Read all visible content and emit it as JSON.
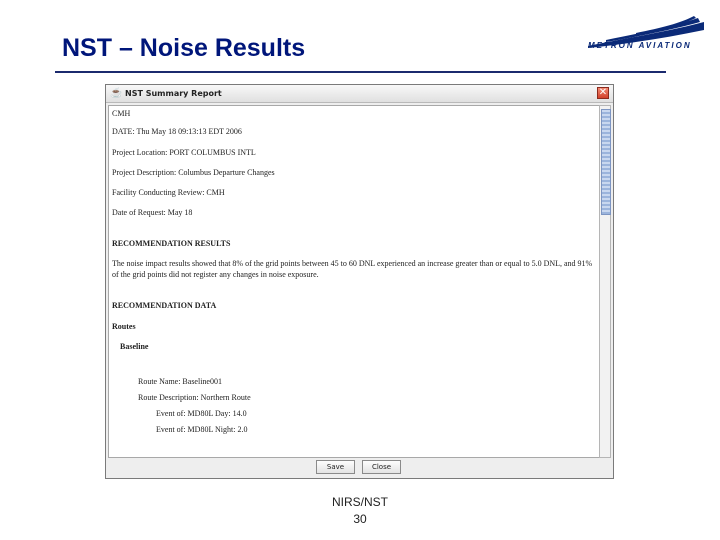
{
  "slide": {
    "title": "NST – Noise Results",
    "logo_text": "METRON AVIATION",
    "footer_line1": "NIRS/NST",
    "footer_line2": "30"
  },
  "dialog": {
    "title": "NST Summary Report",
    "close_glyph": "✕",
    "report": {
      "airport": "CMH",
      "date": "DATE: Thu May 18 09:13:13 EDT 2006",
      "facility": "Project Location: PORT COLUMBUS INTL",
      "description": "Project Description: Columbus Departure Changes",
      "conducting": "Facility Conducting Review: CMH",
      "requested": "Date of Request: May 18",
      "results_heading": "RECOMMENDATION RESULTS",
      "results_text": "The noise impact results showed that 8% of the grid points between 45 to 60 DNL experienced an increase greater than or equal to 5.0 DNL, and 91% of the grid points did not register any changes in noise exposure.",
      "data_heading": "RECOMMENDATION DATA",
      "routes_heading": "Routes",
      "baseline_heading": "Baseline",
      "route_name": "Route Name:       Baseline001",
      "route_description": "Route Description: Northern Route",
      "event_day": "Event of: MD80L Day: 14.0",
      "event_night": "Event of: MD80L Night: 2.0"
    },
    "buttons": {
      "save": "Save",
      "close": "Close"
    }
  },
  "colors": {
    "title": "#00167a",
    "logo": "#0b2a78",
    "close_button": "#d2402a",
    "scrollbar_thumb": "#9bb4dc"
  }
}
